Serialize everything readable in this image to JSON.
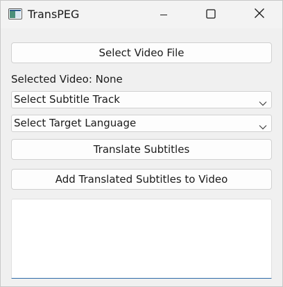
{
  "window": {
    "title": "TransPEG",
    "controls": {
      "minimize_icon": "minimize-icon",
      "maximize_icon": "maximize-icon",
      "close_icon": "close-icon"
    }
  },
  "main": {
    "select_video_button": "Select Video File",
    "selected_video_label": "Selected Video: None",
    "subtitle_track_select": {
      "value": "Select Subtitle Track",
      "icon": "chevron-down-icon"
    },
    "target_language_select": {
      "value": "Select Target Language",
      "icon": "chevron-down-icon"
    },
    "translate_button": "Translate Subtitles",
    "add_subtitles_button": "Add Translated Subtitles to Video",
    "log_output": {
      "value": ""
    }
  },
  "colors": {
    "background": "#f0f0f0",
    "button_bg": "#fdfdfd",
    "border": "#d0d0d0",
    "text_focus_underline": "#2c6aa8"
  }
}
